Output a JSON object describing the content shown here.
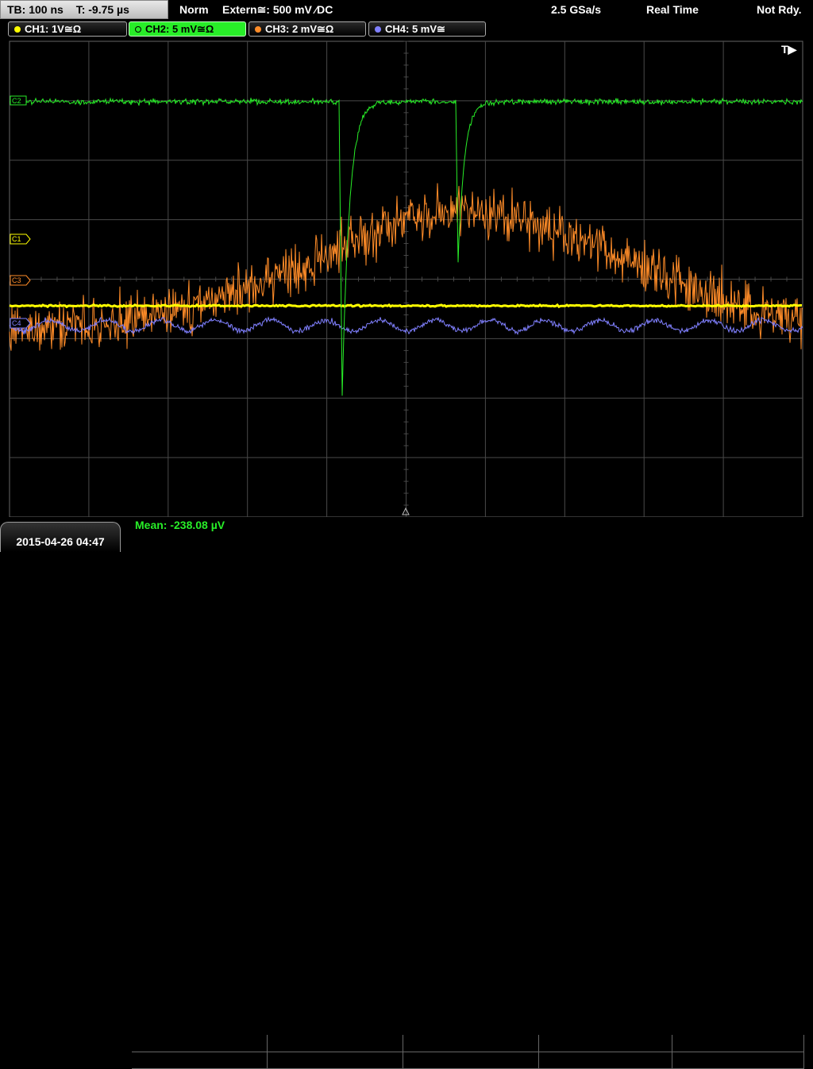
{
  "topbar": {
    "timebase": "TB: 100 ns",
    "trigger_time": "T: -9.75 µs",
    "trigger_mode": "Norm",
    "trigger_source": "Extern≅: 500 mV ⁄DC",
    "sample_rate": "2.5 GSa/s",
    "acq_mode": "Real Time",
    "state": "Not Rdy."
  },
  "channels": [
    {
      "label": "CH1: 1V≅Ω",
      "color": "#ffff00",
      "active": false
    },
    {
      "label": "CH2: 5 mV≅Ω",
      "color": "#28ee28",
      "active": true
    },
    {
      "label": "CH3: 2 mV≅Ω",
      "color": "#ff8c28",
      "active": false
    },
    {
      "label": "CH4: 5 mV≅",
      "color": "#8080ff",
      "active": false
    }
  ],
  "markers": {
    "trigger": "T▶",
    "c1": "C1",
    "c3": "C3",
    "c4": "C4",
    "c2": "C2"
  },
  "footer": {
    "datetime": "2015-04-26 04:47",
    "mean": "Mean: -238.08 µV"
  },
  "colors": {
    "grid": "#4a4a4a",
    "ch1": "#ffff00",
    "ch2": "#28ee28",
    "ch3": "#ff8c28",
    "ch4": "#8080ff"
  }
}
